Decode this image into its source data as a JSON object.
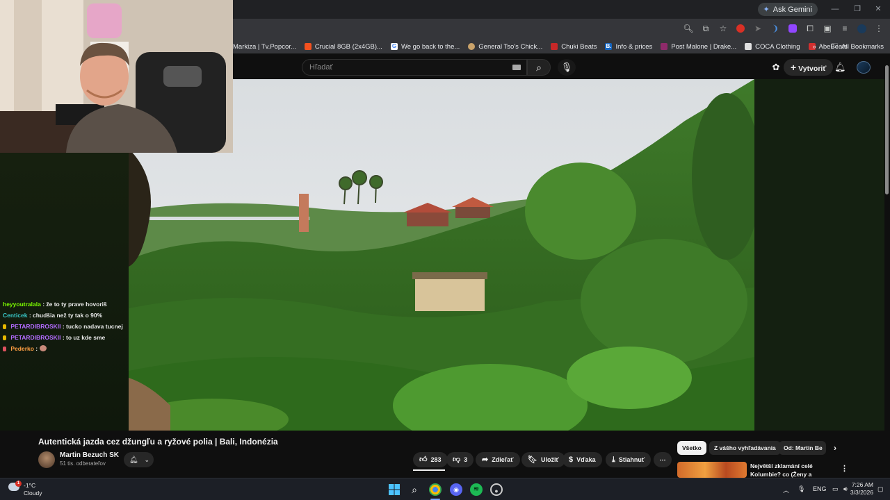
{
  "browser": {
    "ask_gemini": "Ask Gemini",
    "bookmarks": [
      {
        "label": "Markiza | Tv.Popcor...",
        "color": "#3a3a3a"
      },
      {
        "label": "Crucial 8GB (2x4GB)...",
        "color": "#f4511e"
      },
      {
        "label": "We go back to the...",
        "color": "#4285f4"
      },
      {
        "label": "General Tso's Chick...",
        "color": "#caa36a"
      },
      {
        "label": "Chuki Beats",
        "color": "#c62828"
      },
      {
        "label": "Info & prices",
        "color": "#1565c0"
      },
      {
        "label": "Post Malone | Drake...",
        "color": "#8e2a6a"
      },
      {
        "label": "COCA Clothing",
        "color": "#e0e0e0"
      },
      {
        "label": "AbeBeats",
        "color": "#d32f2f"
      }
    ],
    "all_bookmarks": "All Bookmarks"
  },
  "youtube": {
    "search_placeholder": "Hľadať",
    "create_label": "Vytvoriť"
  },
  "chat": [
    {
      "user": "heyyoutralala",
      "color": "#7cfc00",
      "message": ": že to ty prave hovoriš",
      "badge": ""
    },
    {
      "user": "Centicek",
      "color": "#38c7c7",
      "message": ": chudšia než ty tak o 90%",
      "badge": ""
    },
    {
      "user": "PETARDIBROSKII",
      "color": "#b46cff",
      "message": ": tucko nadava tucnej",
      "badge": "#e6b800"
    },
    {
      "user": "PETARDIBROSKII",
      "color": "#b46cff",
      "message": ": to uz kde sme",
      "badge": "#e6b800"
    },
    {
      "user": "Pederko",
      "color": "#ff9f43",
      "message": ":",
      "badge": "#e05260"
    }
  ],
  "video": {
    "title": "Autentická jazda cez džungľu a ryžové polia | Bali, Indonézia",
    "channel": "Martin Bezuch SK",
    "subscribers": "51 tis. odberateľov",
    "likes": "283",
    "dislikes": "3",
    "share": "Zdieľať",
    "save": "Uložiť",
    "thanks": "Vďaka",
    "download": "Stiahnuť"
  },
  "filters": {
    "all": "Všetko",
    "from_search": "Z vášho vyhľadávania",
    "from_channel": "Od: Martin Be"
  },
  "recommendation": {
    "title": "Největší zklamání celé Kolumbie? co (Ženy a Krádeže)"
  },
  "taskbar": {
    "weather_temp": "-1°C",
    "weather_desc": "Cloudy",
    "weather_badge": "1",
    "language": "ENG",
    "time": "7:26 AM",
    "date": "3/3/2026"
  }
}
